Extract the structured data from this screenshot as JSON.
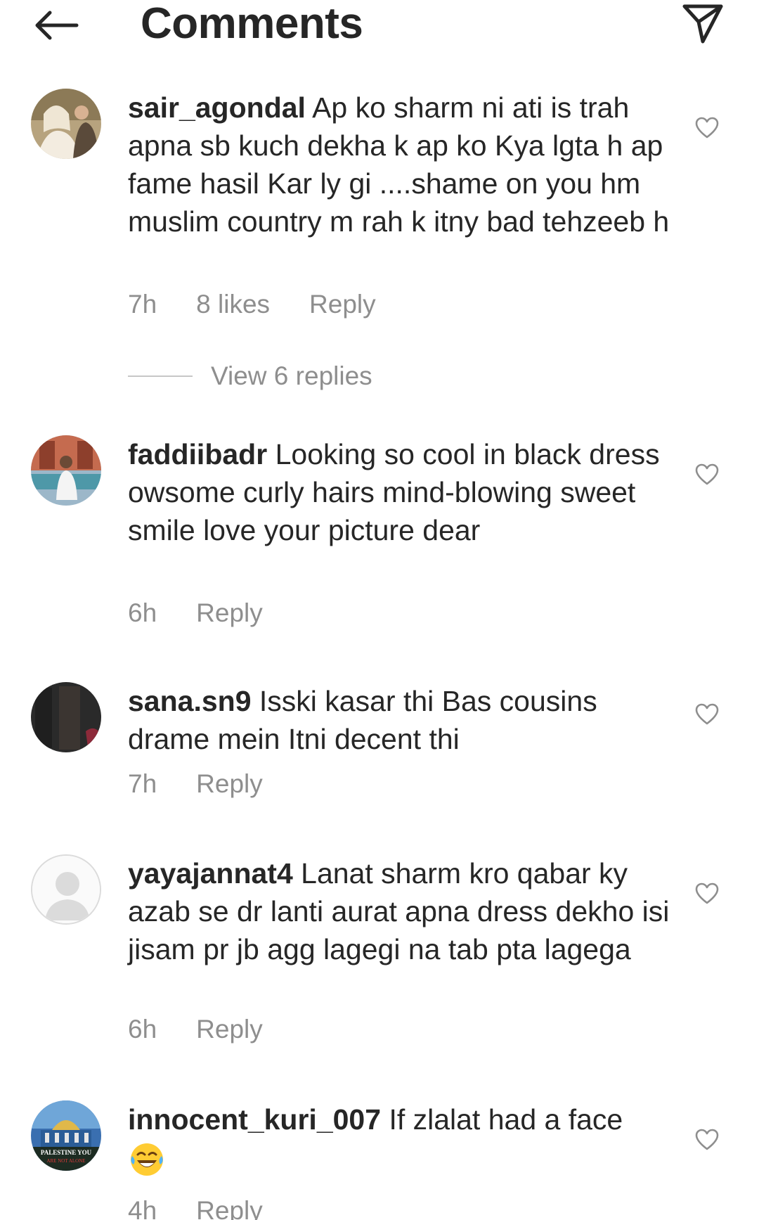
{
  "header": {
    "title": "Comments",
    "back_icon": "arrow-left-icon",
    "send_icon": "paper-plane-icon"
  },
  "comments": [
    {
      "username": "sair_agondal",
      "text": "Ap ko sharm ni ati is trah apna sb kuch dekha k ap ko Kya lgta h ap fame hasil Kar ly gi ....shame on you hm muslim country m rah k itny bad tehzeeb h",
      "time": "7h",
      "likes": "8 likes",
      "reply": "Reply",
      "view_replies": "View 6 replies"
    },
    {
      "username": "faddiibadr",
      "text": "Looking so cool in black dress owsome curly hairs mind-blowing sweet smile love your picture dear",
      "time": "6h",
      "reply": "Reply"
    },
    {
      "username": "sana.sn9",
      "text": "Isski kasar thi Bas cousins drame mein Itni decent thi",
      "time": "7h",
      "reply": "Reply"
    },
    {
      "username": "yayajannat4",
      "text": "Lanat sharm kro qabar ky azab se dr lanti aurat apna dress dekho isi jisam pr jb agg lagegi na tab pta lagega",
      "time": "6h",
      "reply": "Reply"
    },
    {
      "username": "innocent_kuri_007",
      "text": "If zlalat had a face",
      "emoji": "laughing-crying-emoji",
      "time": "4h",
      "reply": "Reply"
    }
  ],
  "avatar_texts": {
    "innocent_badge_line1": "PALESTINE YOU",
    "innocent_badge_line2": "ARE NOT ALONE"
  },
  "colors": {
    "text": "#262626",
    "secondary": "#8e8e8e",
    "divider": "#c7c7c7"
  }
}
